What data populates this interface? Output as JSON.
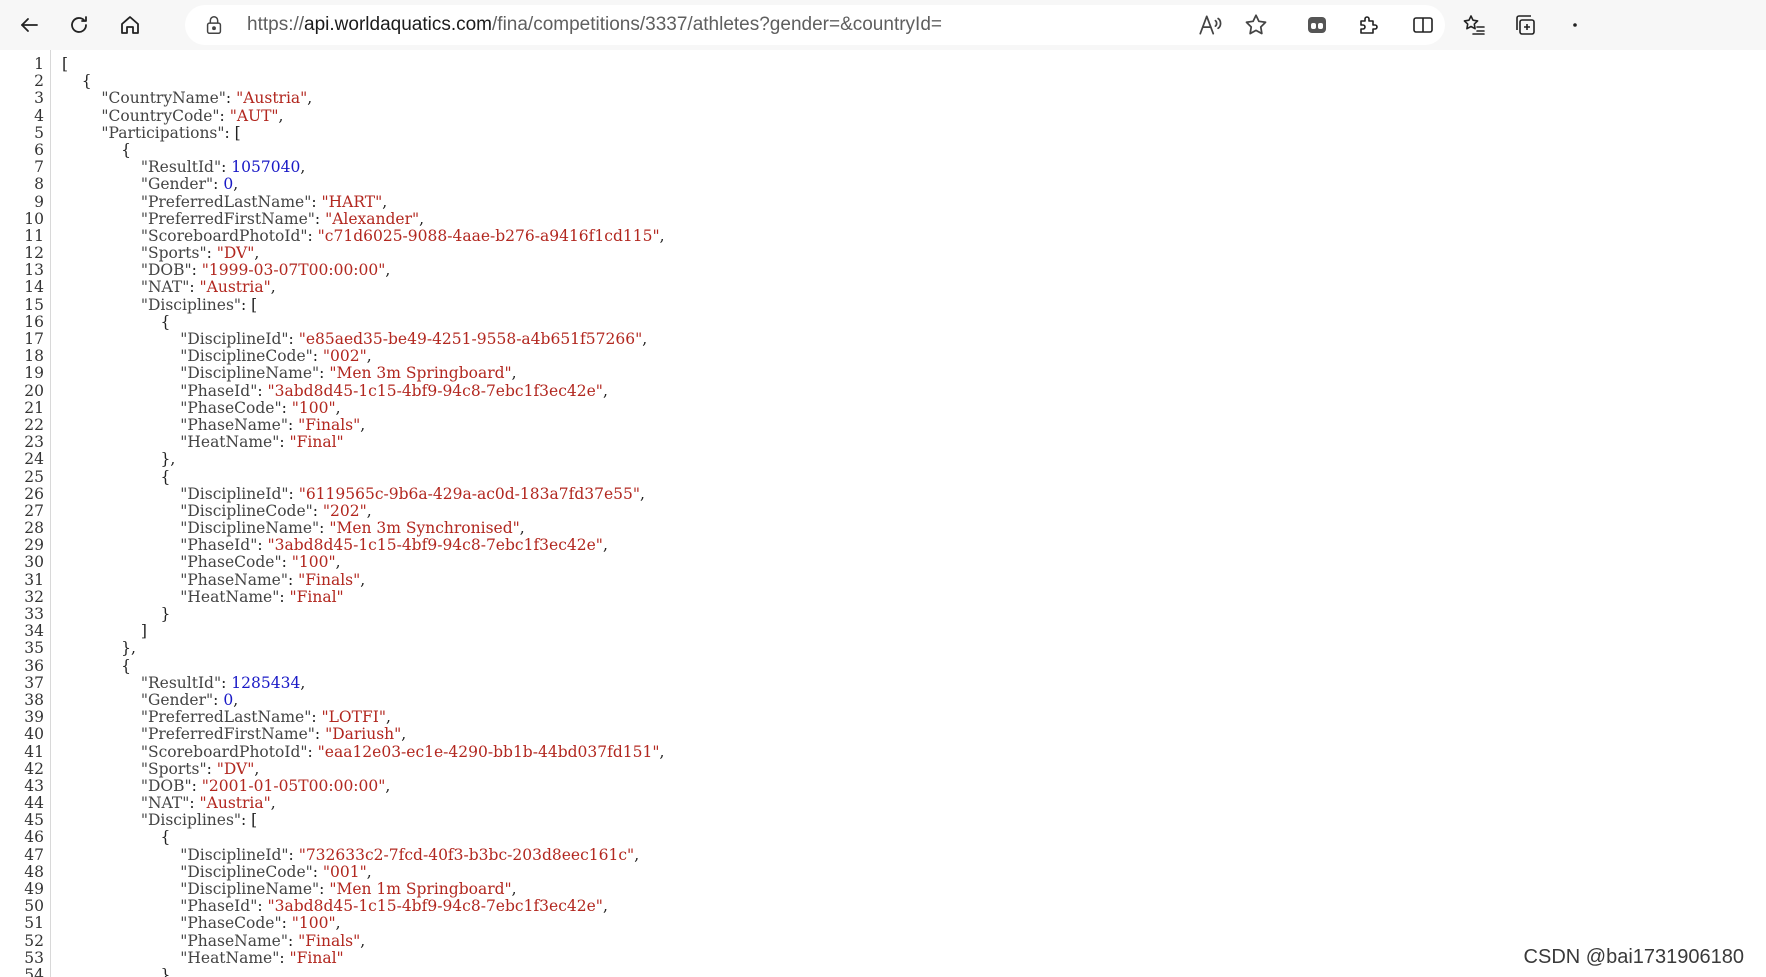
{
  "browser": {
    "url_scheme": "https://",
    "url_host": "api.worldaquatics.com",
    "url_path": "/fina/competitions/3337/athletes?gender=&countryId="
  },
  "watermark": "CSDN @bai1731906180",
  "json_lines": [
    [
      [
        "p",
        "["
      ]
    ],
    [
      [
        "p",
        "    {"
      ]
    ],
    [
      [
        "p",
        "        "
      ],
      [
        "k",
        "\"CountryName\""
      ],
      [
        "p",
        ": "
      ],
      [
        "s",
        "\"Austria\""
      ],
      [
        "p",
        ","
      ]
    ],
    [
      [
        "p",
        "        "
      ],
      [
        "k",
        "\"CountryCode\""
      ],
      [
        "p",
        ": "
      ],
      [
        "s",
        "\"AUT\""
      ],
      [
        "p",
        ","
      ]
    ],
    [
      [
        "p",
        "        "
      ],
      [
        "k",
        "\"Participations\""
      ],
      [
        "p",
        ": ["
      ]
    ],
    [
      [
        "p",
        "            {"
      ]
    ],
    [
      [
        "p",
        "                "
      ],
      [
        "k",
        "\"ResultId\""
      ],
      [
        "p",
        ": "
      ],
      [
        "n",
        "1057040"
      ],
      [
        "p",
        ","
      ]
    ],
    [
      [
        "p",
        "                "
      ],
      [
        "k",
        "\"Gender\""
      ],
      [
        "p",
        ": "
      ],
      [
        "n",
        "0"
      ],
      [
        "p",
        ","
      ]
    ],
    [
      [
        "p",
        "                "
      ],
      [
        "k",
        "\"PreferredLastName\""
      ],
      [
        "p",
        ": "
      ],
      [
        "s",
        "\"HART\""
      ],
      [
        "p",
        ","
      ]
    ],
    [
      [
        "p",
        "                "
      ],
      [
        "k",
        "\"PreferredFirstName\""
      ],
      [
        "p",
        ": "
      ],
      [
        "s",
        "\"Alexander\""
      ],
      [
        "p",
        ","
      ]
    ],
    [
      [
        "p",
        "                "
      ],
      [
        "k",
        "\"ScoreboardPhotoId\""
      ],
      [
        "p",
        ": "
      ],
      [
        "s",
        "\"c71d6025-9088-4aae-b276-a9416f1cd115\""
      ],
      [
        "p",
        ","
      ]
    ],
    [
      [
        "p",
        "                "
      ],
      [
        "k",
        "\"Sports\""
      ],
      [
        "p",
        ": "
      ],
      [
        "s",
        "\"DV\""
      ],
      [
        "p",
        ","
      ]
    ],
    [
      [
        "p",
        "                "
      ],
      [
        "k",
        "\"DOB\""
      ],
      [
        "p",
        ": "
      ],
      [
        "s",
        "\"1999-03-07T00:00:00\""
      ],
      [
        "p",
        ","
      ]
    ],
    [
      [
        "p",
        "                "
      ],
      [
        "k",
        "\"NAT\""
      ],
      [
        "p",
        ": "
      ],
      [
        "s",
        "\"Austria\""
      ],
      [
        "p",
        ","
      ]
    ],
    [
      [
        "p",
        "                "
      ],
      [
        "k",
        "\"Disciplines\""
      ],
      [
        "p",
        ": ["
      ]
    ],
    [
      [
        "p",
        "                    {"
      ]
    ],
    [
      [
        "p",
        "                        "
      ],
      [
        "k",
        "\"DisciplineId\""
      ],
      [
        "p",
        ": "
      ],
      [
        "s",
        "\"e85aed35-be49-4251-9558-a4b651f57266\""
      ],
      [
        "p",
        ","
      ]
    ],
    [
      [
        "p",
        "                        "
      ],
      [
        "k",
        "\"DisciplineCode\""
      ],
      [
        "p",
        ": "
      ],
      [
        "s",
        "\"002\""
      ],
      [
        "p",
        ","
      ]
    ],
    [
      [
        "p",
        "                        "
      ],
      [
        "k",
        "\"DisciplineName\""
      ],
      [
        "p",
        ": "
      ],
      [
        "s",
        "\"Men 3m Springboard\""
      ],
      [
        "p",
        ","
      ]
    ],
    [
      [
        "p",
        "                        "
      ],
      [
        "k",
        "\"PhaseId\""
      ],
      [
        "p",
        ": "
      ],
      [
        "s",
        "\"3abd8d45-1c15-4bf9-94c8-7ebc1f3ec42e\""
      ],
      [
        "p",
        ","
      ]
    ],
    [
      [
        "p",
        "                        "
      ],
      [
        "k",
        "\"PhaseCode\""
      ],
      [
        "p",
        ": "
      ],
      [
        "s",
        "\"100\""
      ],
      [
        "p",
        ","
      ]
    ],
    [
      [
        "p",
        "                        "
      ],
      [
        "k",
        "\"PhaseName\""
      ],
      [
        "p",
        ": "
      ],
      [
        "s",
        "\"Finals\""
      ],
      [
        "p",
        ","
      ]
    ],
    [
      [
        "p",
        "                        "
      ],
      [
        "k",
        "\"HeatName\""
      ],
      [
        "p",
        ": "
      ],
      [
        "s",
        "\"Final\""
      ]
    ],
    [
      [
        "p",
        "                    },"
      ]
    ],
    [
      [
        "p",
        "                    {"
      ]
    ],
    [
      [
        "p",
        "                        "
      ],
      [
        "k",
        "\"DisciplineId\""
      ],
      [
        "p",
        ": "
      ],
      [
        "s",
        "\"6119565c-9b6a-429a-ac0d-183a7fd37e55\""
      ],
      [
        "p",
        ","
      ]
    ],
    [
      [
        "p",
        "                        "
      ],
      [
        "k",
        "\"DisciplineCode\""
      ],
      [
        "p",
        ": "
      ],
      [
        "s",
        "\"202\""
      ],
      [
        "p",
        ","
      ]
    ],
    [
      [
        "p",
        "                        "
      ],
      [
        "k",
        "\"DisciplineName\""
      ],
      [
        "p",
        ": "
      ],
      [
        "s",
        "\"Men 3m Synchronised\""
      ],
      [
        "p",
        ","
      ]
    ],
    [
      [
        "p",
        "                        "
      ],
      [
        "k",
        "\"PhaseId\""
      ],
      [
        "p",
        ": "
      ],
      [
        "s",
        "\"3abd8d45-1c15-4bf9-94c8-7ebc1f3ec42e\""
      ],
      [
        "p",
        ","
      ]
    ],
    [
      [
        "p",
        "                        "
      ],
      [
        "k",
        "\"PhaseCode\""
      ],
      [
        "p",
        ": "
      ],
      [
        "s",
        "\"100\""
      ],
      [
        "p",
        ","
      ]
    ],
    [
      [
        "p",
        "                        "
      ],
      [
        "k",
        "\"PhaseName\""
      ],
      [
        "p",
        ": "
      ],
      [
        "s",
        "\"Finals\""
      ],
      [
        "p",
        ","
      ]
    ],
    [
      [
        "p",
        "                        "
      ],
      [
        "k",
        "\"HeatName\""
      ],
      [
        "p",
        ": "
      ],
      [
        "s",
        "\"Final\""
      ]
    ],
    [
      [
        "p",
        "                    }"
      ]
    ],
    [
      [
        "p",
        "                ]"
      ]
    ],
    [
      [
        "p",
        "            },"
      ]
    ],
    [
      [
        "p",
        "            {"
      ]
    ],
    [
      [
        "p",
        "                "
      ],
      [
        "k",
        "\"ResultId\""
      ],
      [
        "p",
        ": "
      ],
      [
        "n",
        "1285434"
      ],
      [
        "p",
        ","
      ]
    ],
    [
      [
        "p",
        "                "
      ],
      [
        "k",
        "\"Gender\""
      ],
      [
        "p",
        ": "
      ],
      [
        "n",
        "0"
      ],
      [
        "p",
        ","
      ]
    ],
    [
      [
        "p",
        "                "
      ],
      [
        "k",
        "\"PreferredLastName\""
      ],
      [
        "p",
        ": "
      ],
      [
        "s",
        "\"LOTFI\""
      ],
      [
        "p",
        ","
      ]
    ],
    [
      [
        "p",
        "                "
      ],
      [
        "k",
        "\"PreferredFirstName\""
      ],
      [
        "p",
        ": "
      ],
      [
        "s",
        "\"Dariush\""
      ],
      [
        "p",
        ","
      ]
    ],
    [
      [
        "p",
        "                "
      ],
      [
        "k",
        "\"ScoreboardPhotoId\""
      ],
      [
        "p",
        ": "
      ],
      [
        "s",
        "\"eaa12e03-ec1e-4290-bb1b-44bd037fd151\""
      ],
      [
        "p",
        ","
      ]
    ],
    [
      [
        "p",
        "                "
      ],
      [
        "k",
        "\"Sports\""
      ],
      [
        "p",
        ": "
      ],
      [
        "s",
        "\"DV\""
      ],
      [
        "p",
        ","
      ]
    ],
    [
      [
        "p",
        "                "
      ],
      [
        "k",
        "\"DOB\""
      ],
      [
        "p",
        ": "
      ],
      [
        "s",
        "\"2001-01-05T00:00:00\""
      ],
      [
        "p",
        ","
      ]
    ],
    [
      [
        "p",
        "                "
      ],
      [
        "k",
        "\"NAT\""
      ],
      [
        "p",
        ": "
      ],
      [
        "s",
        "\"Austria\""
      ],
      [
        "p",
        ","
      ]
    ],
    [
      [
        "p",
        "                "
      ],
      [
        "k",
        "\"Disciplines\""
      ],
      [
        "p",
        ": ["
      ]
    ],
    [
      [
        "p",
        "                    {"
      ]
    ],
    [
      [
        "p",
        "                        "
      ],
      [
        "k",
        "\"DisciplineId\""
      ],
      [
        "p",
        ": "
      ],
      [
        "s",
        "\"732633c2-7fcd-40f3-b3bc-203d8eec161c\""
      ],
      [
        "p",
        ","
      ]
    ],
    [
      [
        "p",
        "                        "
      ],
      [
        "k",
        "\"DisciplineCode\""
      ],
      [
        "p",
        ": "
      ],
      [
        "s",
        "\"001\""
      ],
      [
        "p",
        ","
      ]
    ],
    [
      [
        "p",
        "                        "
      ],
      [
        "k",
        "\"DisciplineName\""
      ],
      [
        "p",
        ": "
      ],
      [
        "s",
        "\"Men 1m Springboard\""
      ],
      [
        "p",
        ","
      ]
    ],
    [
      [
        "p",
        "                        "
      ],
      [
        "k",
        "\"PhaseId\""
      ],
      [
        "p",
        ": "
      ],
      [
        "s",
        "\"3abd8d45-1c15-4bf9-94c8-7ebc1f3ec42e\""
      ],
      [
        "p",
        ","
      ]
    ],
    [
      [
        "p",
        "                        "
      ],
      [
        "k",
        "\"PhaseCode\""
      ],
      [
        "p",
        ": "
      ],
      [
        "s",
        "\"100\""
      ],
      [
        "p",
        ","
      ]
    ],
    [
      [
        "p",
        "                        "
      ],
      [
        "k",
        "\"PhaseName\""
      ],
      [
        "p",
        ": "
      ],
      [
        "s",
        "\"Finals\""
      ],
      [
        "p",
        ","
      ]
    ],
    [
      [
        "p",
        "                        "
      ],
      [
        "k",
        "\"HeatName\""
      ],
      [
        "p",
        ": "
      ],
      [
        "s",
        "\"Final\""
      ]
    ],
    [
      [
        "p",
        "                    }"
      ]
    ]
  ],
  "line_numbers": [
    "1",
    "2",
    "3",
    "4",
    "5",
    "6",
    "7",
    "8",
    "9",
    "10",
    "11",
    "12",
    "13",
    "14",
    "15",
    "16",
    "17",
    "18",
    "19",
    "20",
    "21",
    "22",
    "23",
    "24",
    "25",
    "26",
    "27",
    "28",
    "29",
    "30",
    "31",
    "32",
    "33",
    "34",
    "35",
    "36",
    "37",
    "38",
    "39",
    "40",
    "41",
    "42",
    "43",
    "44",
    "45",
    "46",
    "47",
    "48",
    "49",
    "50",
    "51",
    "52",
    "53",
    "54"
  ]
}
